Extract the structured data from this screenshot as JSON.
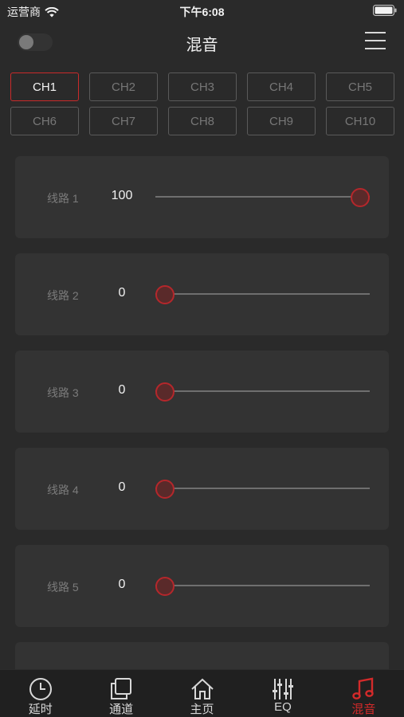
{
  "status_bar": {
    "carrier": "运营商",
    "time": "下午6:08"
  },
  "nav": {
    "title": "混音"
  },
  "colors": {
    "accent": "#d32a2a",
    "background": "#2a2a2a",
    "card": "#333333"
  },
  "channels": {
    "active": "CH1",
    "rows": [
      [
        "CH1",
        "CH2",
        "CH3",
        "CH4",
        "CH5"
      ],
      [
        "CH6",
        "CH7",
        "CH8",
        "CH9",
        "CH10"
      ]
    ]
  },
  "lines": {
    "max": 100,
    "items": [
      {
        "label": "线路 1",
        "value": "100"
      },
      {
        "label": "线路 2",
        "value": "0"
      },
      {
        "label": "线路 3",
        "value": "0"
      },
      {
        "label": "线路 4",
        "value": "0"
      },
      {
        "label": "线路 5",
        "value": "0"
      }
    ]
  },
  "tabs": [
    {
      "label": "延时",
      "icon": "clock-icon",
      "active": false
    },
    {
      "label": "通道",
      "icon": "copy-icon",
      "active": false
    },
    {
      "label": "主页",
      "icon": "home-icon",
      "active": false
    },
    {
      "label": "EQ",
      "icon": "equalizer-icon",
      "active": false
    },
    {
      "label": "混音",
      "icon": "music-note-icon",
      "active": true
    }
  ]
}
